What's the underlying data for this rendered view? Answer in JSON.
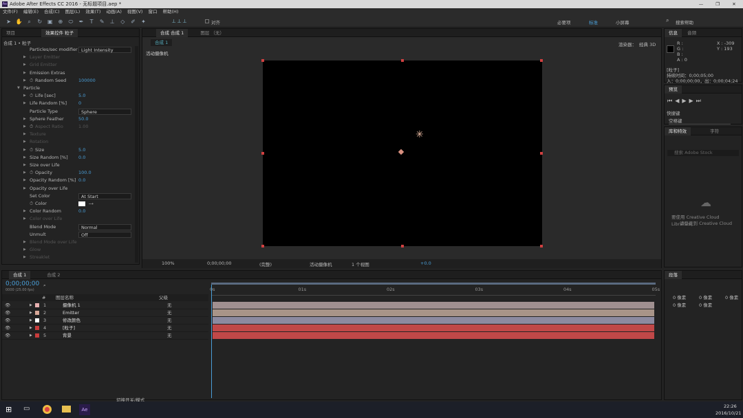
{
  "app": {
    "title": "Adobe After Effects CC 2016 - 无标题项目.aep *"
  },
  "menu": [
    "文件(F)",
    "编辑(E)",
    "合成(C)",
    "图层(L)",
    "效果(T)",
    "动画(A)",
    "视图(V)",
    "窗口",
    "帮助(H)"
  ],
  "toolbar": {
    "snap_label": "对齐",
    "workspaces": [
      "必要项",
      "标准",
      "小屏幕"
    ],
    "search_help": "搜索帮助"
  },
  "left_panel": {
    "tabs": [
      "项目",
      "效果控件 粒子"
    ],
    "breadcrumb": "合成 1 • 粒子",
    "props": [
      {
        "name": "Particles/sec modifier",
        "value": "Light Intensity",
        "type": "dropdown",
        "indent": 2
      },
      {
        "name": "Layer Emitter",
        "value": "",
        "dim": true,
        "indent": 2,
        "arrow": true
      },
      {
        "name": "Grid Emitter",
        "value": "",
        "dim": true,
        "indent": 2,
        "arrow": true
      },
      {
        "name": "Emission Extras",
        "value": "",
        "indent": 2,
        "arrow": true
      },
      {
        "name": "Random Seed",
        "value": "100000",
        "indent": 2,
        "arrow": true,
        "stopwatch": true
      },
      {
        "name": "Particle",
        "value": "",
        "indent": 1,
        "arrow": true,
        "open": true
      },
      {
        "name": "Life [sec]",
        "value": "5.0",
        "indent": 2,
        "arrow": true,
        "stopwatch": true
      },
      {
        "name": "Life Random [%]",
        "value": "0",
        "indent": 2,
        "arrow": true
      },
      {
        "name": "Particle Type",
        "value": "Sphere",
        "type": "dropdown",
        "indent": 2
      },
      {
        "name": "Sphere Feather",
        "value": "50.0",
        "indent": 2,
        "arrow": true
      },
      {
        "name": "Aspect Ratio",
        "value": "1.00",
        "dim": true,
        "indent": 2,
        "arrow": true,
        "stopwatch": true
      },
      {
        "name": "Texture",
        "value": "",
        "dim": true,
        "indent": 2,
        "arrow": true
      },
      {
        "name": "Rotation",
        "value": "",
        "dim": true,
        "indent": 2,
        "arrow": true
      },
      {
        "name": "Size",
        "value": "5.0",
        "indent": 2,
        "arrow": true,
        "stopwatch": true
      },
      {
        "name": "Size Random [%]",
        "value": "0.0",
        "indent": 2,
        "arrow": true
      },
      {
        "name": "Size over Life",
        "value": "",
        "indent": 2,
        "arrow": true
      },
      {
        "name": "Opacity",
        "value": "100.0",
        "indent": 2,
        "arrow": true,
        "stopwatch": true
      },
      {
        "name": "Opacity Random [%]",
        "value": "0.0",
        "indent": 2,
        "arrow": true
      },
      {
        "name": "Opacity over Life",
        "value": "",
        "indent": 2,
        "arrow": true
      },
      {
        "name": "Set Color",
        "value": "At Start",
        "type": "dropdown",
        "indent": 2
      },
      {
        "name": "Color",
        "value": "",
        "type": "color",
        "indent": 2,
        "stopwatch": true
      },
      {
        "name": "Color Random",
        "value": "0.0",
        "indent": 2,
        "arrow": true
      },
      {
        "name": "Color over Life",
        "value": "",
        "dim": true,
        "indent": 2,
        "arrow": true
      },
      {
        "name": "Blend Mode",
        "value": "Normal",
        "type": "dropdown",
        "indent": 2
      },
      {
        "name": "Unmult",
        "value": "Off",
        "type": "dropdown",
        "indent": 2
      },
      {
        "name": "Blend Mode over Life",
        "value": "",
        "dim": true,
        "indent": 2,
        "arrow": true
      },
      {
        "name": "Glow",
        "value": "",
        "dim": true,
        "indent": 2,
        "arrow": true
      },
      {
        "name": "Streaklet",
        "value": "",
        "dim": true,
        "indent": 2,
        "arrow": true
      }
    ]
  },
  "comp_panel": {
    "tab": "合成 合成 1",
    "tab2": "图层 （无）",
    "subtab": "合成 1",
    "camera_label": "活动摄像机",
    "renderer_label": "渲染器：",
    "renderer_value": "经典 3D",
    "zoom": "100%",
    "timecode": "0;00;00;00",
    "quality": "(完整)",
    "view": "活动摄像机",
    "views_count": "1 个视图",
    "exposure": "+0.0"
  },
  "info_panel": {
    "tabs": [
      "信息",
      "音频"
    ],
    "r": "R :",
    "g": "G :",
    "b": "B :",
    "a": "A : 0",
    "x": "X : -309",
    "y": "Y : 193",
    "layer": "[粒子]",
    "duration": "持续时间：0;00;05;00",
    "inout": "入：0;00;00;00，出：0;00;04;24"
  },
  "preview_panel": {
    "title": "预览",
    "shortcut_label": "快捷键",
    "shortcut_value": "空格键"
  },
  "libraries_panel": {
    "tabs": [
      "库和特效",
      "字符"
    ],
    "search_placeholder": "搜索 Adobe Stock",
    "message1": "要使用 Creative Cloud Libraries，",
    "message2": "请登录到 Creative Cloud"
  },
  "paragraph_panel": {
    "title": "段落",
    "fields": [
      "0 像素",
      "0 像素",
      "0 像素",
      "0 像素",
      "0 像素"
    ]
  },
  "timeline": {
    "tabs": [
      "合成 1",
      "合成 2"
    ],
    "timecode": "0;00;00;00",
    "frame_info": "0000 (25.00 fps)",
    "header_num": "#",
    "header_name": "图层名称",
    "header_parent": "父级",
    "ruler": [
      "0s",
      "01s",
      "02s",
      "03s",
      "04s",
      "05s"
    ],
    "toggle_label": "切换开关/模式",
    "layers": [
      {
        "num": "1",
        "name": "摄像机 1",
        "color": "#e8b0b0",
        "parent": "无",
        "bar": "#a09090"
      },
      {
        "num": "2",
        "name": "Emitter",
        "color": "#d8a898",
        "parent": "无",
        "bar": "#a89488"
      },
      {
        "num": "3",
        "name": "修改颜色",
        "color": "#ffffff",
        "parent": "无",
        "bar": "#8c8aa0"
      },
      {
        "num": "4",
        "name": "[粒子]",
        "color": "#c83c3c",
        "parent": "无",
        "bar": "#c04848"
      },
      {
        "num": "5",
        "name": "背景",
        "color": "#c83c3c",
        "parent": "无",
        "bar": "#c04848"
      }
    ]
  },
  "taskbar": {
    "time": "22:26",
    "date": "2016/10/21"
  },
  "colors": {
    "accent": "#4a9fd8",
    "red_layer": "#c83c3c"
  }
}
